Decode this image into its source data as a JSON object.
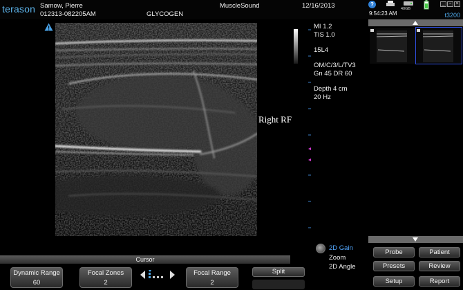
{
  "header": {
    "logo": "terason",
    "patient_name": "Samow, Pierre",
    "patient_id": "012313-082205AM",
    "exam_label": "GLYCOGEN",
    "institution": "MuscleSound",
    "date": "12/16/2013",
    "time": "9:54:23 AM",
    "drive_label": "40GB",
    "model": "t3200",
    "icons": [
      "help-icon",
      "printer-icon",
      "drive-icon",
      "power-icon",
      "minimize-icon",
      "restore-icon",
      "close-icon"
    ]
  },
  "imaging_params": {
    "mi": "MI  1.2",
    "tis": "TIS 1.0",
    "probe": "15L4",
    "mode": "OM/C/3/L/TV3",
    "gain_dr": "Gn 45   DR 60",
    "depth": "Depth 4 cm",
    "frame_rate": "20 Hz"
  },
  "annotation": "Right RF",
  "controls": {
    "cursor_label": "Cursor",
    "dynamic_range": {
      "label": "Dynamic Range",
      "value": "60"
    },
    "focal_zones": {
      "label": "Focal Zones",
      "value": "2"
    },
    "focal_range": {
      "label": "Focal Range",
      "value": "2"
    },
    "split_label": "Split"
  },
  "knob_menu": {
    "items": [
      "2D Gain",
      "Zoom",
      "2D Angle"
    ],
    "active": "2D Gain"
  },
  "right_buttons": {
    "probe": "Probe",
    "patient": "Patient",
    "presets": "Presets",
    "review": "Review",
    "setup": "Setup",
    "report": "Report"
  },
  "colors": {
    "accent_blue": "#4ea7e6",
    "active_knob_text": "#54a8ff",
    "selection_outline": "#2f4fe0"
  }
}
